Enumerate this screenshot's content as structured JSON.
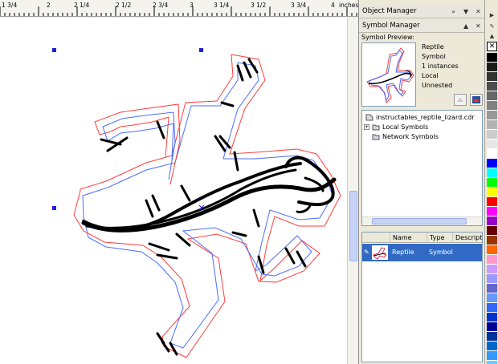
{
  "ruler": {
    "labels": [
      "1 3/4",
      "2",
      "2 1/4",
      "2 1/2",
      "2 3/4",
      "3",
      "3 1/4",
      "3 1/2",
      "3 3/4",
      "4"
    ],
    "unit": "inches"
  },
  "object_manager": {
    "title": "Object Manager"
  },
  "symbol_manager": {
    "title": "Symbol Manager",
    "preview_label": "Symbol Preview:",
    "info": [
      "Reptile",
      "Symbol",
      "1 instances",
      "Local",
      "Unnested"
    ],
    "tree": [
      {
        "label": "instructables_reptile_lizard.cdr",
        "icon": "document-icon"
      },
      {
        "label": "Local Symbols",
        "icon": "folder-icon"
      },
      {
        "label": "Network Symbols",
        "icon": "folder-icon"
      }
    ],
    "table": {
      "headers": [
        "Name",
        "Type",
        "Description"
      ],
      "rows": [
        {
          "name": "Reptile",
          "type": "Symbol",
          "description": ""
        }
      ]
    }
  },
  "palette": {
    "colors": [
      "#000000",
      "#1a1a1a",
      "#333333",
      "#4d4d4d",
      "#666666",
      "#808080",
      "#999999",
      "#b3b3b3",
      "#cccccc",
      "#e6e6e6",
      "#ffffff",
      "#0000ff",
      "#00ffff",
      "#00ff00",
      "#ffff00",
      "#ff0000",
      "#ff00ff",
      "#9900cc",
      "#660000",
      "#993300",
      "#ff6600",
      "#ff99cc",
      "#cc99ff",
      "#9999ff",
      "#6666cc",
      "#6699ff",
      "#3366ff",
      "#0033cc",
      "#000099",
      "#003399",
      "#0066cc",
      "#3399ff",
      "#66ccff"
    ]
  }
}
